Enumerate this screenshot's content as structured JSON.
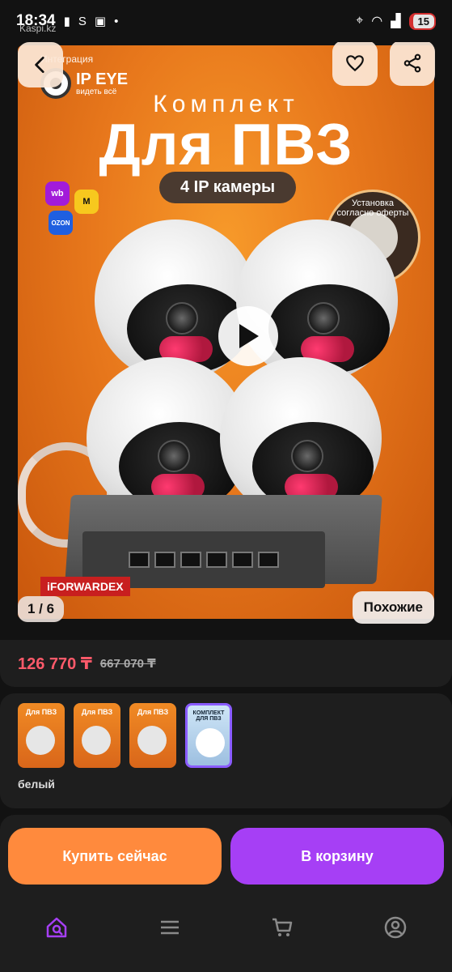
{
  "status_bar": {
    "time": "18:34",
    "battery": "15",
    "site": "Kaspi.kz"
  },
  "hero": {
    "brand_top": "Интеграция",
    "brand_name": "IP EYE",
    "brand_tagline": "видеть всё",
    "title_small": "Комплект",
    "title_big": "Для ПВЗ",
    "pill": "4 IP камеры",
    "circle_badge": "Установка согласно оферты",
    "marketplaces": [
      "wb",
      "M",
      "OZON"
    ],
    "switch_brand": "iFORWARDEX",
    "image_counter": "1 / 6",
    "similar_label": "Похожие"
  },
  "price": {
    "current": "126 770 ₸",
    "old": "667 070 ₸"
  },
  "variants": {
    "thumb_title": "Для ПВЗ",
    "selected_title": "КОМПЛЕКТ ДЛЯ ПВЗ",
    "color_label": "белый"
  },
  "actions": {
    "buy_now": "Купить сейчас",
    "add_to_cart": "В корзину"
  },
  "nav": {
    "items": [
      "home-search-icon",
      "menu-icon",
      "cart-icon",
      "profile-icon"
    ]
  },
  "colors": {
    "accent_orange": "#ff8a3d",
    "accent_purple": "#a63ff5",
    "price_red": "#ff5a6a",
    "selected_border": "#8a5cff"
  }
}
